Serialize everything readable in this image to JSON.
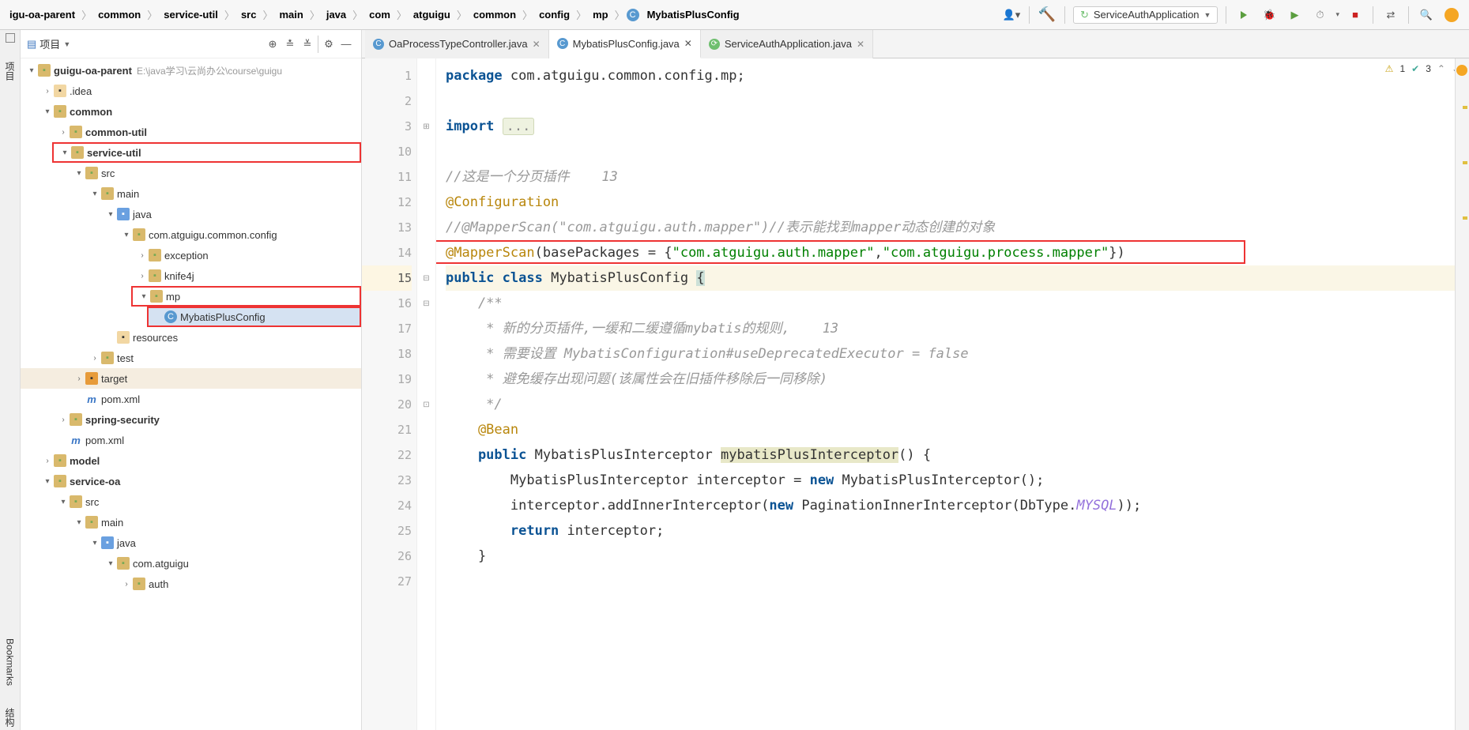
{
  "breadcrumb": [
    "igu-oa-parent",
    "common",
    "service-util",
    "src",
    "main",
    "java",
    "com",
    "atguigu",
    "common",
    "config",
    "mp",
    "MybatisPlusConfig"
  ],
  "runConfig": "ServiceAuthApplication",
  "sidebar": {
    "project_title": "项目",
    "tool_project": "项目",
    "tool_bookmarks": "Bookmarks",
    "tool_structure": "结构"
  },
  "tree": {
    "root": {
      "label": "guigu-oa-parent",
      "path": "E:\\java学习\\云尚办公\\course\\guigu"
    },
    "idea": ".idea",
    "common": "common",
    "common_util": "common-util",
    "service_util": "service-util",
    "src": "src",
    "main": "main",
    "java": "java",
    "pkg": "com.atguigu.common.config",
    "exception": "exception",
    "knife4j": "knife4j",
    "mp": "mp",
    "mpc": "MybatisPlusConfig",
    "resources": "resources",
    "test": "test",
    "target": "target",
    "pom": "pom.xml",
    "spring_sec": "spring-security",
    "pom2": "pom.xml",
    "model": "model",
    "service_oa": "service-oa",
    "src2": "src",
    "main2": "main",
    "java2": "java",
    "pkg2": "com.atguigu",
    "auth": "auth"
  },
  "tabs": [
    {
      "icon": "c",
      "label": "OaProcessTypeController.java",
      "active": false
    },
    {
      "icon": "c",
      "label": "MybatisPlusConfig.java",
      "active": true
    },
    {
      "icon": "s",
      "label": "ServiceAuthApplication.java",
      "active": false
    }
  ],
  "status": {
    "warn": "1",
    "ok": "3"
  },
  "code": {
    "line_numbers": [
      1,
      2,
      3,
      10,
      11,
      12,
      13,
      14,
      15,
      16,
      17,
      18,
      19,
      20,
      21,
      22,
      23,
      24,
      25,
      26,
      27
    ],
    "l1_pkg": "package",
    "l1_rest": " com.atguigu.common.config.mp;",
    "l3_imp": "import",
    "l3_fold": "...",
    "l11_cmt": "//这是一个分页插件    13",
    "l12_ann": "@Configuration",
    "l13_cmt": "//@MapperScan(\"com.atguigu.auth.mapper\")//表示能找到mapper动态创建的对象",
    "l14_a": "@MapperScan",
    "l14_b": "(basePackages = {",
    "l14_s1": "\"com.atguigu.auth.mapper\"",
    "l14_c": ",",
    "l14_s2": "\"com.atguigu.process.mapper\"",
    "l14_d": "})",
    "l15_a": "public",
    "l15_b": "class",
    "l15_c": "MybatisPlusConfig ",
    "l15_brace": "{",
    "l16": "    /**",
    "l17": "     * 新的分页插件,一缓和二缓遵循mybatis的规则,    13",
    "l18": "     * 需要设置 MybatisConfiguration#useDeprecatedExecutor = false",
    "l19": "     * 避免缓存出现问题(该属性会在旧插件移除后一同移除)",
    "l20": "     */",
    "l21": "    @Bean",
    "l22_a": "    public",
    "l22_b": " MybatisPlusInterceptor ",
    "l22_c": "mybatisPlusInterceptor",
    "l22_d": "() {",
    "l23_a": "        MybatisPlusInterceptor interceptor = ",
    "l23_new": "new",
    "l23_b": " MybatisPlusInterceptor();",
    "l24_a": "        interceptor.addInnerInterceptor(",
    "l24_new": "new",
    "l24_b": " PaginationInnerInterceptor(DbType.",
    "l24_it": "MYSQL",
    "l24_c": "));",
    "l25_a": "        return",
    "l25_b": " interceptor;",
    "l26": "    }"
  }
}
